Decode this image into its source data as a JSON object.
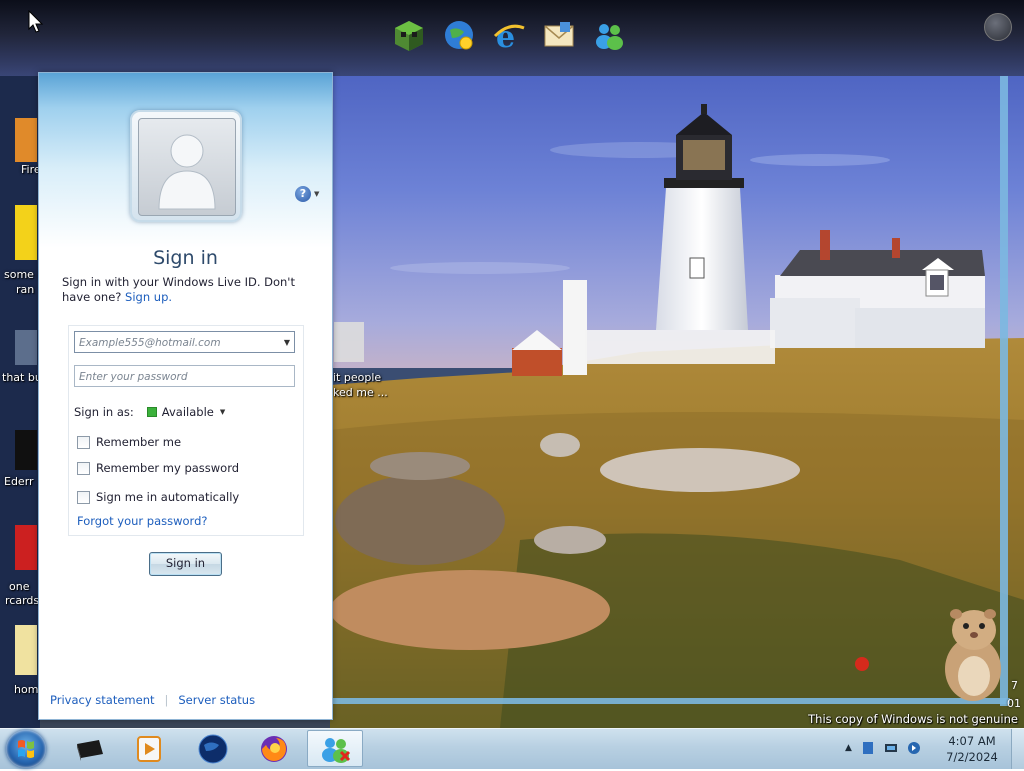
{
  "messenger": {
    "title": "Sign in",
    "description": "Sign in with your Windows Live ID. Don't have one?",
    "signup_link": "Sign up.",
    "email_placeholder": "Example555@hotmail.com",
    "password_placeholder": "Enter your password",
    "status_label": "Sign in as:",
    "status_value": "Available",
    "remember_me": "Remember me",
    "remember_password": "Remember my password",
    "auto_signin": "Sign me in automatically",
    "forgot_password": "Forgot your password?",
    "signin_button": "Sign in",
    "privacy_link": "Privacy statement",
    "server_status_link": "Server status"
  },
  "desktop": {
    "labels": [
      "Fire",
      "some i",
      "ran",
      "that bu",
      "it people",
      "ked me ...",
      "Ederr",
      "one",
      "rcards",
      "hom"
    ],
    "genuine_notice": "This copy of Windows is not genuine",
    "build_line1": "7",
    "build_line2": "01"
  },
  "dock": {
    "icons": [
      "minecraft-icon",
      "globe-network-icon",
      "internet-explorer-icon",
      "mail-icon",
      "messenger-icon"
    ]
  },
  "taskbar": {
    "time": "4:07 AM",
    "date": "7/2/2024",
    "buttons": [
      "terminal-icon",
      "media-player-icon",
      "globe-browser-icon",
      "firefox-icon",
      "messenger-icon"
    ]
  },
  "colors": {
    "link": "#1d5ebd",
    "status_available": "#3bb13b",
    "taskbar": "#b8d0e2"
  }
}
